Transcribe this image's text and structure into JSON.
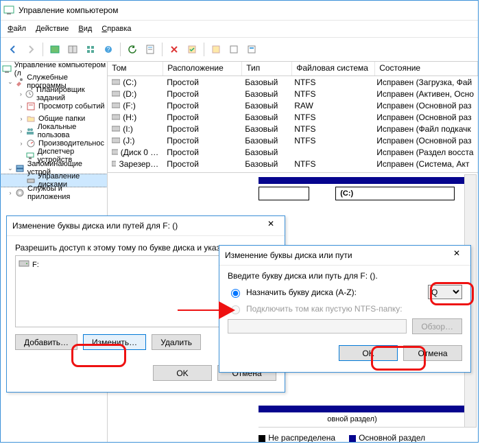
{
  "window": {
    "title": "Управление компьютером"
  },
  "menu": {
    "file": "Файл",
    "action": "Действие",
    "view": "Вид",
    "help": "Справка"
  },
  "tree": {
    "root": "Управление компьютером (л",
    "tools_group": "Служебные программы",
    "tools": {
      "sched": "Планировщик заданий",
      "event": "Просмотр событий",
      "shared": "Общие папки",
      "users": "Локальные пользова",
      "perf": "Производительнос",
      "devmgr": "Диспетчер устройств"
    },
    "storage_group": "Запоминающие устрой",
    "diskmgmt": "Управление дисками",
    "services": "Службы и приложения"
  },
  "columns": {
    "c1": "Том",
    "c2": "Расположение",
    "c3": "Тип",
    "c4": "Файловая система",
    "c5": "Состояние"
  },
  "simple": "Простой",
  "basic": "Базовый",
  "rows": [
    {
      "vol": "(C:)",
      "fs": "NTFS",
      "state": "Исправен (Загрузка, Фай"
    },
    {
      "vol": "(D:)",
      "fs": "NTFS",
      "state": "Исправен (Активен, Осно"
    },
    {
      "vol": "(F:)",
      "fs": "RAW",
      "state": "Исправен (Основной раз"
    },
    {
      "vol": "(H:)",
      "fs": "NTFS",
      "state": "Исправен (Основной раз"
    },
    {
      "vol": "(I:)",
      "fs": "NTFS",
      "state": "Исправен (Файл подкачк"
    },
    {
      "vol": "(J:)",
      "fs": "NTFS",
      "state": "Исправен (Основной раз"
    },
    {
      "vol": "(Диск 0 …",
      "fs": "",
      "state": "Исправен (Раздел восста"
    },
    {
      "vol": "Зарезер…",
      "fs": "NTFS",
      "state": "Исправен (Система, Акт"
    }
  ],
  "map": {
    "label_c": "(C:)",
    "leg_unalloc": "Не распределена",
    "leg_primary": "Основной раздел",
    "partial": "овной раздел)"
  },
  "dlg1": {
    "title": "Изменение буквы диска или путей для F: ()",
    "subtitle": "Разрешить доступ к этому тому по букве диска и указан",
    "drive": "F:",
    "add": "Добавить…",
    "change": "Изменить…",
    "remove": "Удалить",
    "ok": "OK",
    "cancel": "Отмена"
  },
  "dlg2": {
    "title": "Изменение буквы диска или пути",
    "prompt": "Введите букву диска или путь для F: ().",
    "opt_assign": "Назначить букву диска (A-Z):",
    "opt_mount": "Подключить том как пустую NTFS-папку:",
    "letter": "Q",
    "browse": "Обзор…",
    "ok": "OK",
    "cancel": "Отмена"
  }
}
